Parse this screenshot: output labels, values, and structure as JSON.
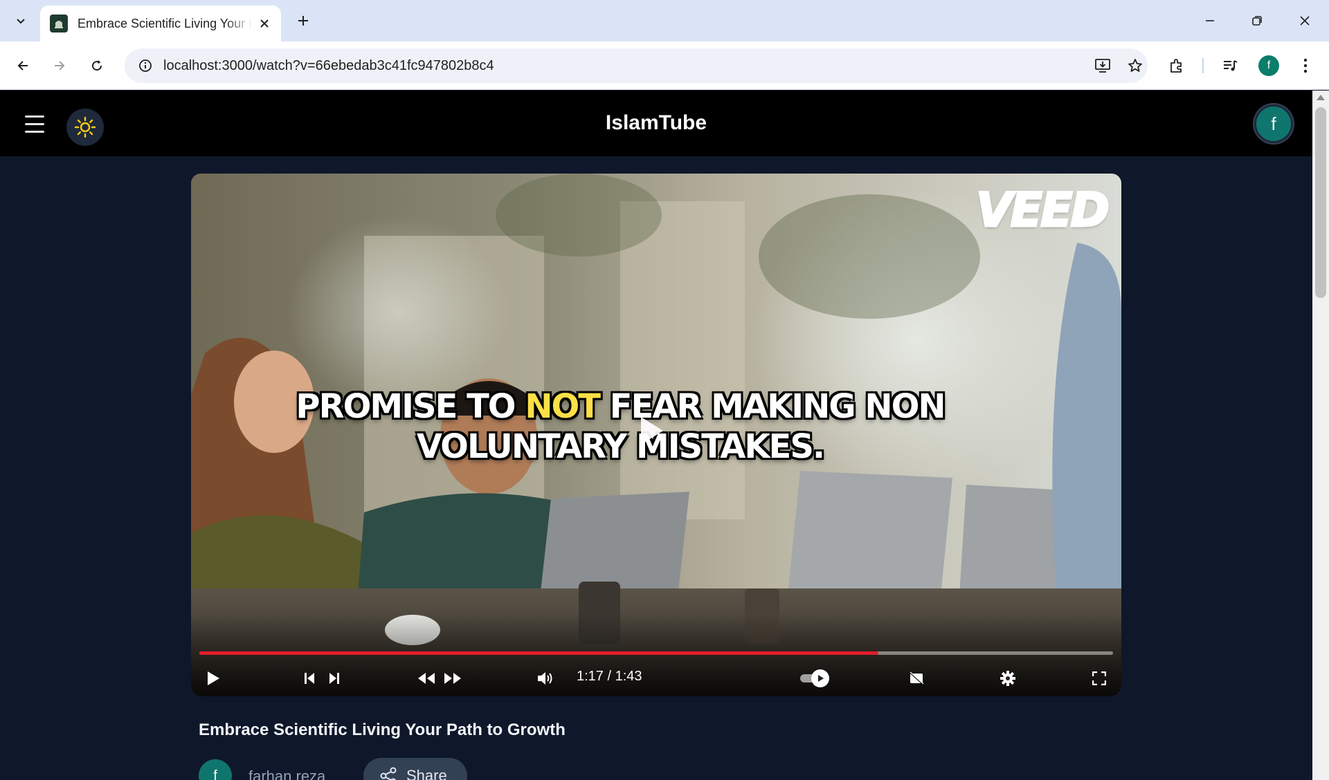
{
  "browser": {
    "tab": {
      "title": "Embrace Scientific Living Your Path to Growth"
    },
    "url": "localhost:3000/watch?v=66ebedab3c41fc947802b8c4",
    "profile_initial": "f",
    "icons": [
      "tab-list-icon",
      "close-icon",
      "plus-icon",
      "minimize-icon",
      "restore-icon",
      "back-icon",
      "forward-icon",
      "reload-icon",
      "site-info-icon",
      "install-app-icon",
      "star-icon",
      "extensions-icon",
      "media-queue-icon",
      "kebab-menu-icon"
    ]
  },
  "app": {
    "brand": "IslamTube",
    "avatar_initial": "f",
    "theme_icon": "sun-icon"
  },
  "player": {
    "watermark": "VEED",
    "caption": {
      "part1": "PROMISE TO ",
      "highlight": "NOT",
      "part2": " FEAR MAKING NON VOLUNTARY MISTAKES."
    },
    "time_display": "1:17 / 1:43",
    "progress": 0.743,
    "buffered": 1.0,
    "colors": {
      "progress": "#e11d2a",
      "highlight": "#fde047"
    }
  },
  "video": {
    "title": "Embrace Scientific Living Your Path to Growth",
    "channel_initial": "f",
    "channel_name": "farhan reza",
    "share_label": "Share"
  }
}
